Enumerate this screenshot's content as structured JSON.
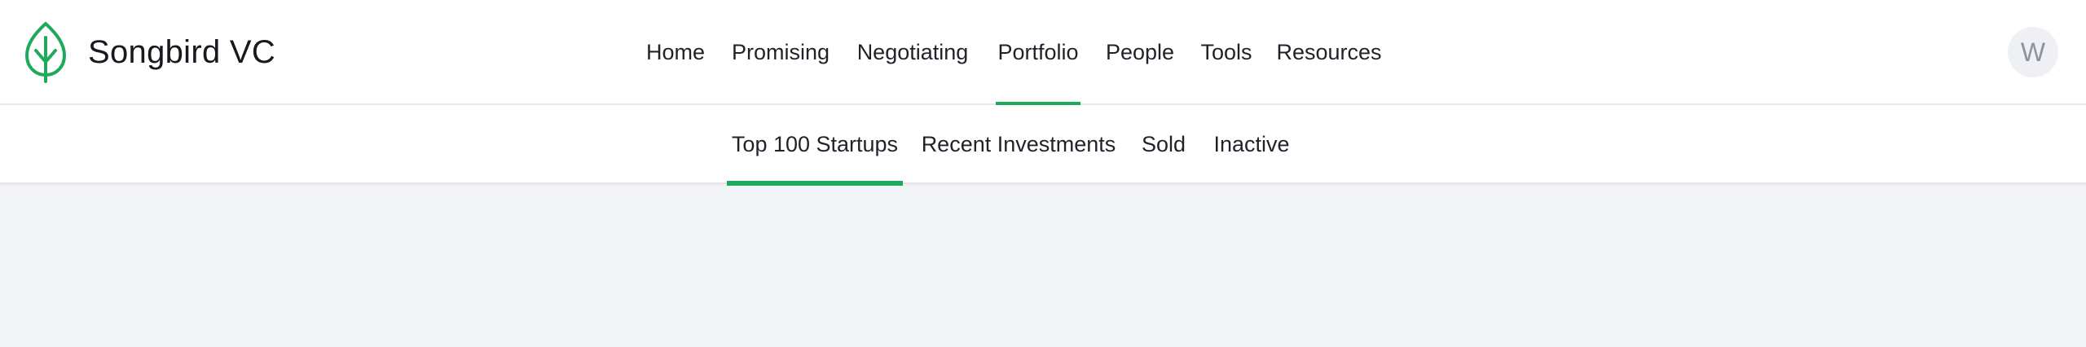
{
  "brand": {
    "name": "Songbird VC",
    "logo_icon": "leaf-icon",
    "accent_color": "#1faa5b"
  },
  "main_nav": {
    "items": [
      {
        "label": "Home",
        "active": false
      },
      {
        "label": "Promising",
        "active": false
      },
      {
        "label": "Negotiating",
        "active": false
      },
      {
        "label": "Portfolio",
        "active": true
      },
      {
        "label": "People",
        "active": false
      },
      {
        "label": "Tools",
        "active": false
      },
      {
        "label": "Resources",
        "active": false
      }
    ]
  },
  "user": {
    "avatar_initial": "W"
  },
  "sub_nav": {
    "items": [
      {
        "label": "Top 100 Startups",
        "active": true
      },
      {
        "label": "Recent Investments",
        "active": false
      },
      {
        "label": "Sold",
        "active": false
      },
      {
        "label": "Inactive",
        "active": false
      }
    ]
  },
  "colors": {
    "page_background": "#f3f4f7",
    "bar_background": "#ffffff",
    "active_indicator": "#1faa5b"
  }
}
